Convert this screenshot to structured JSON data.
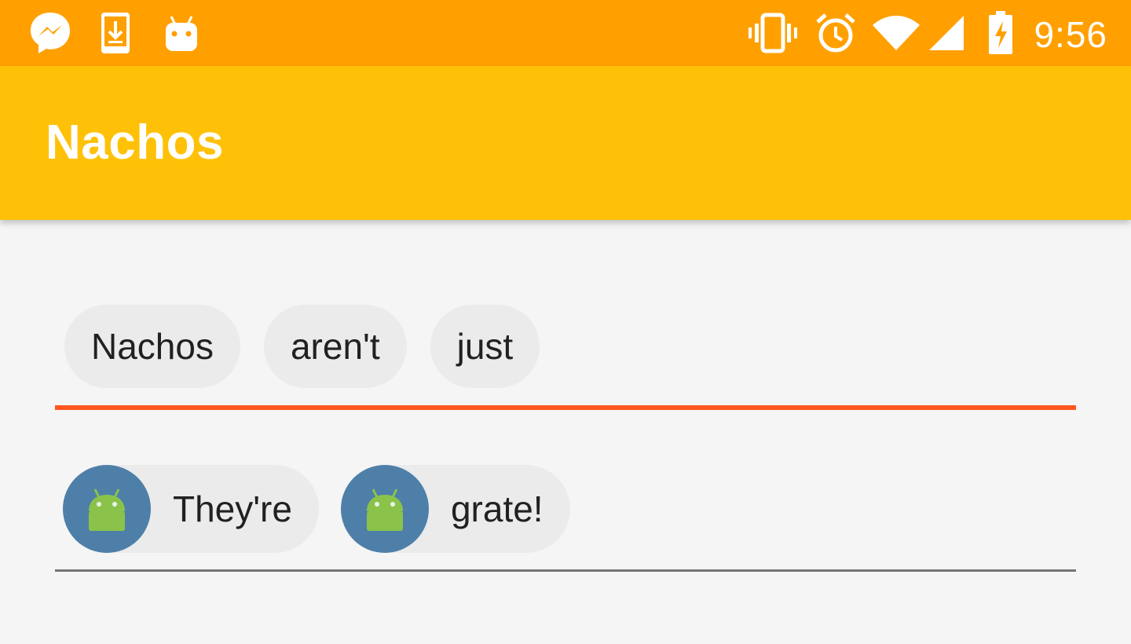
{
  "status_bar": {
    "time": "9:56",
    "left_icons": [
      "messenger-icon",
      "download-icon",
      "android-icon"
    ],
    "right_icons": [
      "vibrate-icon",
      "alarm-icon",
      "wifi-icon",
      "signal-icon",
      "battery-charging-icon"
    ]
  },
  "app_bar": {
    "title": "Nachos"
  },
  "chip_field_1": {
    "state": "focused",
    "chips": [
      {
        "label": "Nachos"
      },
      {
        "label": "aren't"
      },
      {
        "label": "just"
      }
    ]
  },
  "chip_field_2": {
    "state": "unfocused",
    "chips": [
      {
        "label": "They're",
        "icon": "android-avatar-icon"
      },
      {
        "label": "grate!",
        "icon": "android-avatar-icon"
      }
    ]
  },
  "colors": {
    "status_bar": "#FFA000",
    "app_bar": "#FFC107",
    "accent_underline": "#FF5722",
    "chip_background": "#EBEBEB",
    "avatar_background": "#4E7FA8",
    "android_green": "#8BC34A"
  }
}
